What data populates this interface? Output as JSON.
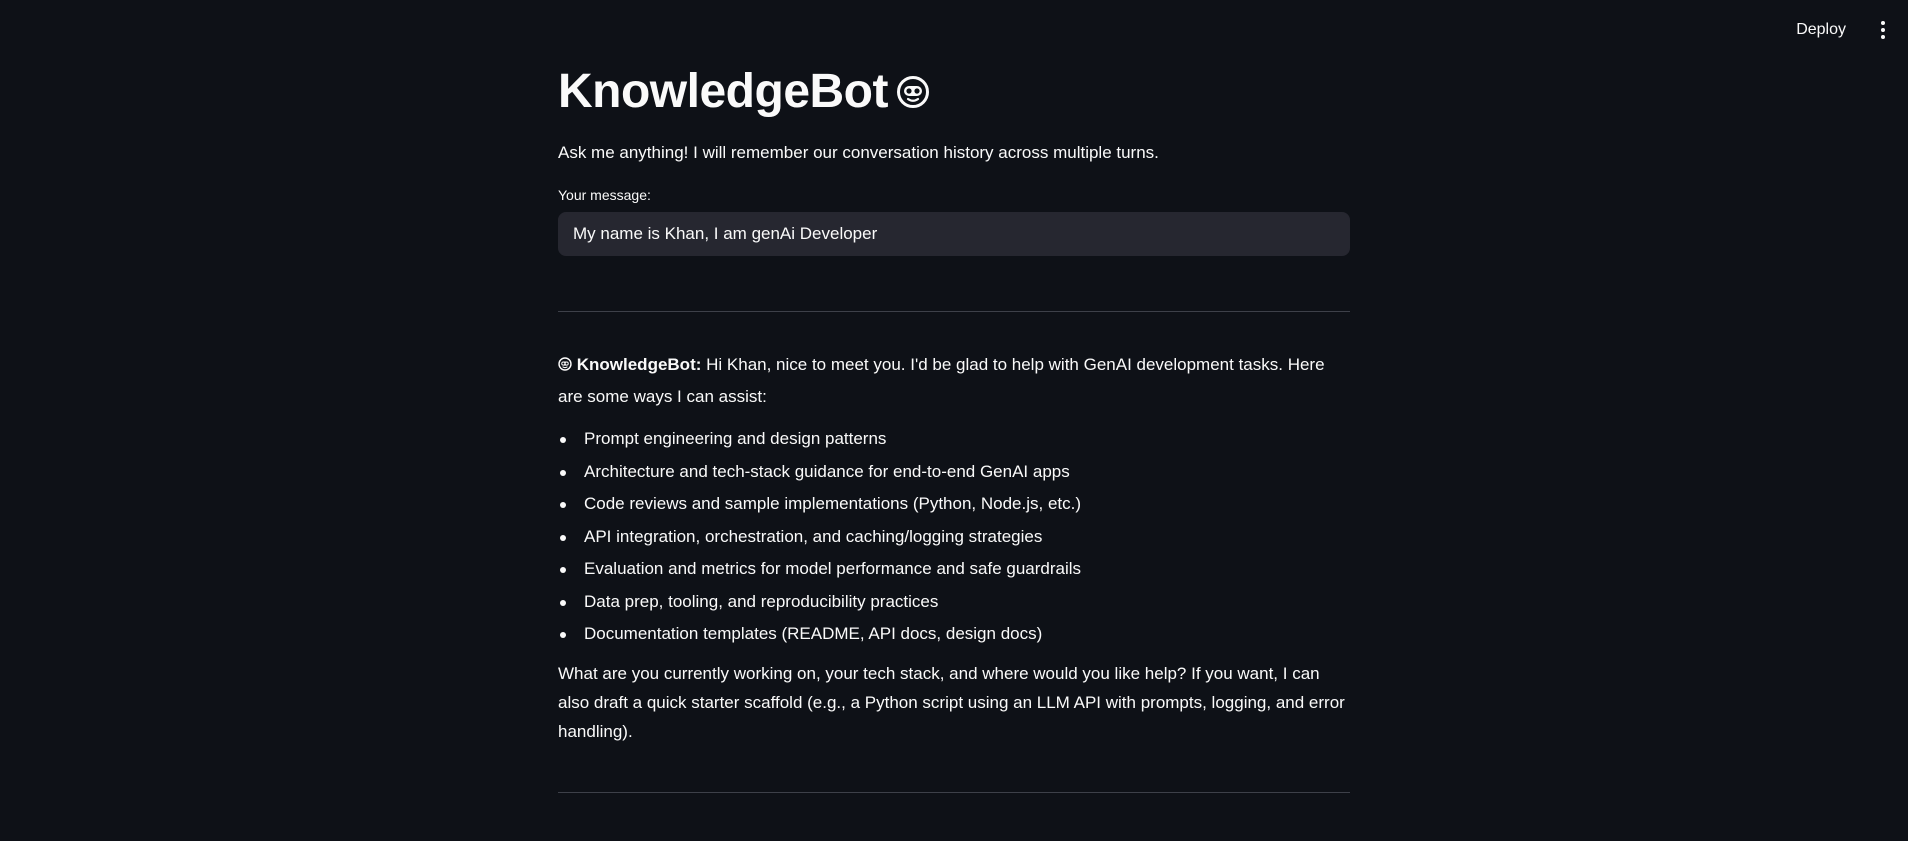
{
  "toolbar": {
    "deploy_label": "Deploy",
    "menu_icon": "more-vertical-icon"
  },
  "header": {
    "title": "KnowledgeBot",
    "title_icon": "robot-face-icon"
  },
  "intro": {
    "subtitle": "Ask me anything! I will remember our conversation history across multiple turns."
  },
  "input": {
    "label": "Your message:",
    "value": "My name is Khan, I am genAi Developer"
  },
  "response": {
    "speaker": "KnowledgeBot:",
    "speaker_icon": "robot-face-icon",
    "opening": "Hi Khan, nice to meet you. I'd be glad to help with GenAI development tasks. Here are some ways I can assist:",
    "bullets": [
      "Prompt engineering and design patterns",
      "Architecture and tech-stack guidance for end-to-end GenAI apps",
      "Code reviews and sample implementations (Python, Node.js, etc.)",
      "API integration, orchestration, and caching/logging strategies",
      "Evaluation and metrics for model performance and safe guardrails",
      "Data prep, tooling, and reproducibility practices",
      "Documentation templates (README, API docs, design docs)"
    ],
    "closing": "What are you currently working on, your tech stack, and where would you like help? If you want, I can also draft a quick starter scaffold (e.g., a Python script using an LLM API with prompts, logging, and error handling)."
  },
  "colors": {
    "background": "#0e1117",
    "text": "#fafafa",
    "input_background": "#262730",
    "divider": "#3d4049"
  }
}
